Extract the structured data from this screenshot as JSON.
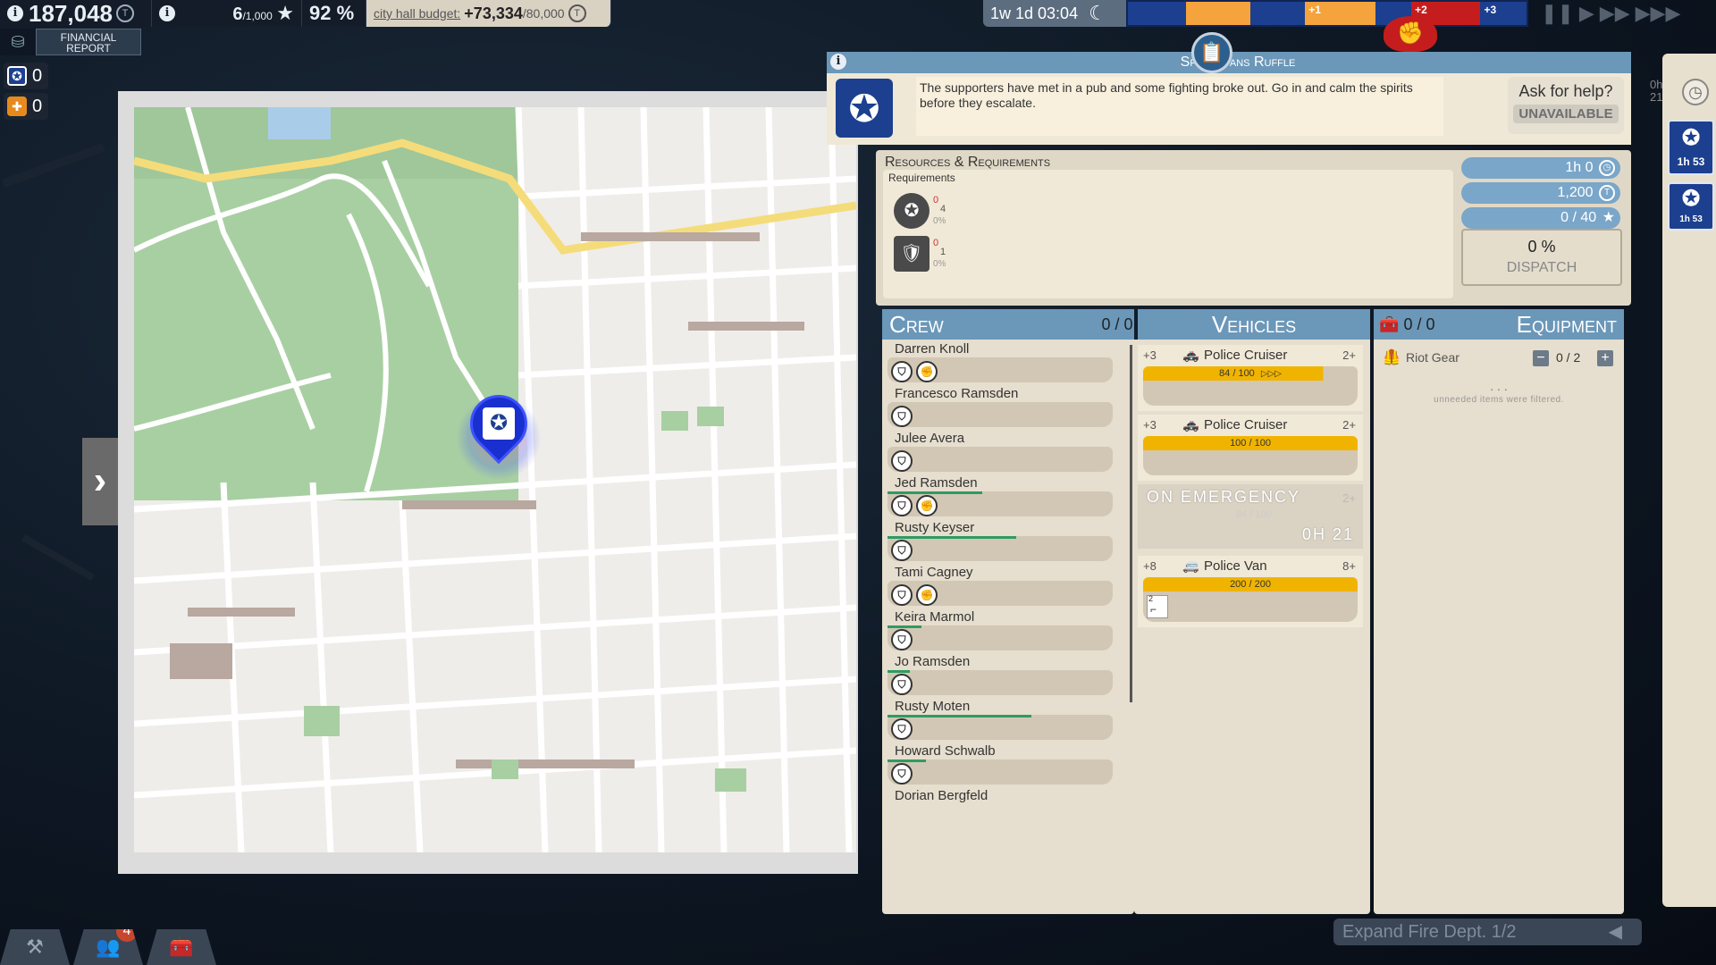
{
  "hud": {
    "money": "187,048",
    "coin_symbol": "T",
    "rating": "6",
    "rating_max": "/1,000",
    "approval": "92 %",
    "budget_label": "city hall budget:",
    "budget_value": "+73,334",
    "budget_max": "/80,000"
  },
  "financial_report": {
    "label_line1": "FINANCIAL",
    "label_line2": "REPORT"
  },
  "unit_counters": [
    {
      "icon": "police-icon",
      "count": "0",
      "color": "#1c3f8f"
    },
    {
      "icon": "medic-icon",
      "count": "0",
      "color": "#e68a1e"
    }
  ],
  "time": {
    "label": "1w 1d 03:04"
  },
  "timeline": {
    "markers": [
      "+1",
      "+2",
      "+3"
    ]
  },
  "mission": {
    "title": "Sport Fans Ruffle",
    "description": "The supporters have met in a pub and some fighting broke out. Go in and calm the spirits before they escalate.",
    "ask_help_question": "Ask for help?",
    "ask_help_status": "UNAVAILABLE",
    "rr_title": "Resources & Requirements",
    "requirements_label": "Requirements",
    "requirements": [
      {
        "icon": "police-officer-icon",
        "have": "0",
        "need": "4",
        "pct": "0%"
      },
      {
        "icon": "riot-officer-icon",
        "have": "0",
        "need": "1",
        "pct": "0%"
      }
    ],
    "stats": {
      "time": "1h 0",
      "cost": "1,200",
      "rating": "0 / 40"
    },
    "dispatch_pct": "0 %",
    "dispatch_label": "DISPATCH"
  },
  "crew": {
    "title": "Crew",
    "count": "0 / 0",
    "members": [
      {
        "name": "Darren Knoll",
        "xp": 0.0,
        "skills": [
          "badge",
          "brawler"
        ]
      },
      {
        "name": "Francesco Ramsden",
        "xp": 0.0,
        "skills": [
          "badge"
        ]
      },
      {
        "name": "Julee Avera",
        "xp": 0.0,
        "skills": [
          "badge"
        ]
      },
      {
        "name": "Jed Ramsden",
        "xp": 0.42,
        "skills": [
          "badge",
          "brawler"
        ]
      },
      {
        "name": "Rusty Keyser",
        "xp": 0.57,
        "skills": [
          "badge"
        ]
      },
      {
        "name": "Tami Cagney",
        "xp": 0.0,
        "skills": [
          "badge",
          "brawler"
        ]
      },
      {
        "name": "Keira Marmol",
        "xp": 0.15,
        "skills": [
          "badge"
        ]
      },
      {
        "name": "Jo Ramsden",
        "xp": 0.1,
        "skills": [
          "badge"
        ]
      },
      {
        "name": "Rusty Moten",
        "xp": 0.64,
        "skills": [
          "badge"
        ]
      },
      {
        "name": "Howard Schwalb",
        "xp": 0.17,
        "skills": [
          "badge"
        ]
      },
      {
        "name": "Dorian Bergfeld",
        "xp": 0.0,
        "skills": []
      }
    ]
  },
  "vehicles": {
    "title": "Vehicles",
    "items": [
      {
        "bonus": "+3",
        "name": "Police Cruiser",
        "cap": "2+",
        "fuel": "84 / 100",
        "fuel_fraction": 0.84,
        "boost": true,
        "status": ""
      },
      {
        "bonus": "+3",
        "name": "Police Cruiser",
        "cap": "2+",
        "fuel": "100 / 100",
        "fuel_fraction": 1.0,
        "boost": false,
        "status": ""
      },
      {
        "bonus": "",
        "name": "",
        "cap": "2+",
        "fuel": "84 / 100",
        "fuel_fraction": 0.84,
        "boost": false,
        "status": "ON EMERGENCY",
        "eta": "0H 21"
      },
      {
        "bonus": "+8",
        "name": "Police Van",
        "cap": "8+",
        "fuel": "200 / 200",
        "fuel_fraction": 1.0,
        "boost": false,
        "status": "",
        "equipment_count": "2"
      }
    ]
  },
  "equipment": {
    "title": "Equipment",
    "count": "0 / 0",
    "items": [
      {
        "name": "Riot Gear",
        "qty": "0 / 2"
      }
    ],
    "ellipsis": ". . .",
    "filter_note": "unneeded items were filtered."
  },
  "tracker": {
    "header_time": "0h 21",
    "items": [
      {
        "time": "1h 53"
      },
      {
        "time": "1h 53"
      }
    ]
  },
  "bottom_tabs": {
    "notification_count": "4"
  },
  "expand_banner": "Expand Fire Dept. 1/2",
  "colors": {
    "panel_header": "#6b97b9",
    "police_blue": "#1c3f8f",
    "fuel": "#f0b400",
    "xp": "#2e9b62"
  }
}
